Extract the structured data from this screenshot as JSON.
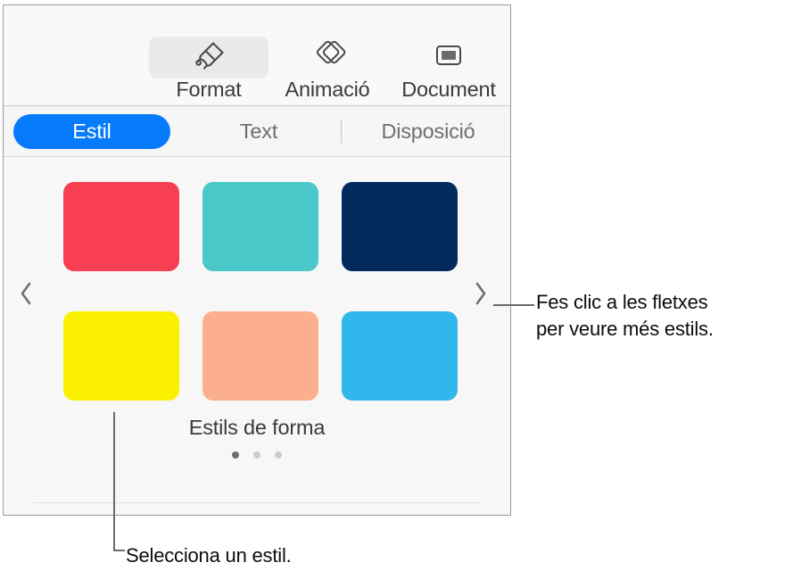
{
  "panel": {
    "header": {
      "buttons": [
        {
          "id": "format",
          "label": "Format",
          "icon": "paintbrush-icon",
          "selected": true
        },
        {
          "id": "animacio",
          "label": "Animació",
          "icon": "animation-diamonds-icon",
          "selected": false
        },
        {
          "id": "document",
          "label": "Document",
          "icon": "document-slide-icon",
          "selected": false
        }
      ]
    },
    "tabs": [
      {
        "id": "estil",
        "label": "Estil",
        "selected": true
      },
      {
        "id": "text",
        "label": "Text",
        "selected": false
      },
      {
        "id": "disposicio",
        "label": "Disposició",
        "selected": false
      }
    ],
    "style_picker": {
      "caption": "Estils de forma",
      "prev_arrow": "chevron-left-icon",
      "next_arrow": "chevron-right-icon",
      "swatches": [
        {
          "name": "swatch-red",
          "color": "#F83E52"
        },
        {
          "name": "swatch-teal",
          "color": "#4AC7C9"
        },
        {
          "name": "swatch-navy",
          "color": "#032A5D"
        },
        {
          "name": "swatch-yellow",
          "color": "#FAF000"
        },
        {
          "name": "swatch-peach",
          "color": "#FCAF8C"
        },
        {
          "name": "swatch-skyblue",
          "color": "#2FB7EE"
        }
      ],
      "page_dots": [
        {
          "active": true
        },
        {
          "active": false
        },
        {
          "active": false
        }
      ]
    }
  },
  "callouts": {
    "arrows": "Fes clic a les fletxes\nper veure més estils.",
    "select_style": "Selecciona un estil."
  },
  "colors": {
    "accent_blue": "#057AFA",
    "panel_background": "#F7F7F7",
    "panel_border": "#9A9A9A",
    "selected_pill": "#EAEAEA",
    "text_primary": "#3B3B3B",
    "text_muted": "#6F6F6F"
  }
}
